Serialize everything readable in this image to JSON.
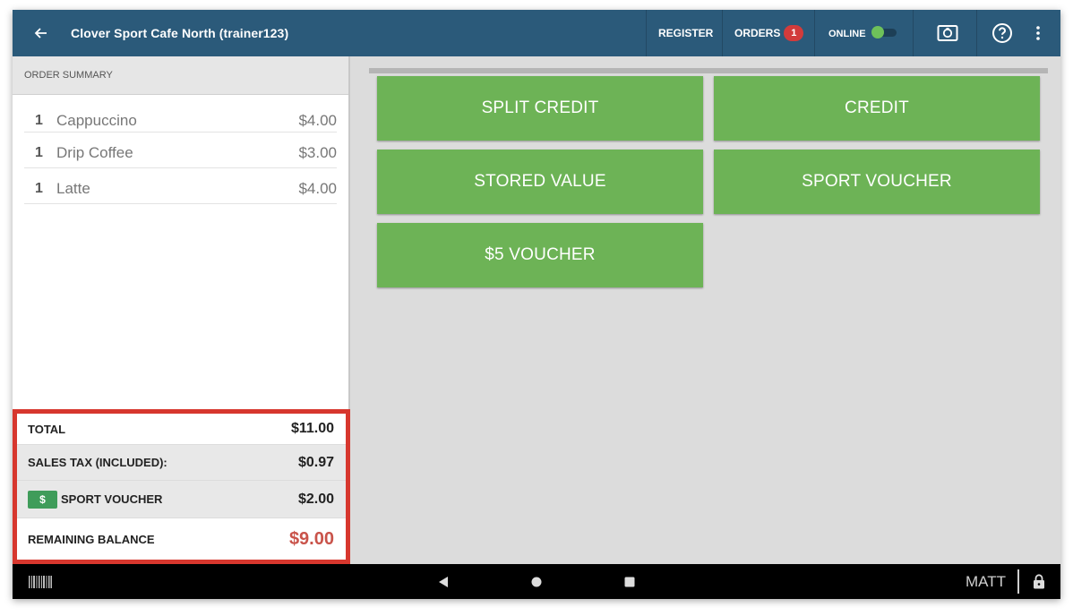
{
  "header": {
    "title": "Clover Sport Cafe North (trainer123)",
    "register_label": "REGISTER",
    "orders_label": "ORDERS",
    "orders_count": "1",
    "online_label": "ONLINE"
  },
  "order_summary": {
    "header": "ORDER SUMMARY",
    "items": [
      {
        "qty": "1",
        "name": "Cappuccino",
        "price": "$4.00"
      },
      {
        "qty": "1",
        "name": "Drip Coffee",
        "price": "$3.00"
      },
      {
        "qty": "1",
        "name": "Latte",
        "price": "$4.00"
      }
    ],
    "totals": {
      "total_label": "TOTAL",
      "total_value": "$11.00",
      "tax_label": "SALES TAX (INCLUDED):",
      "tax_value": "$0.97",
      "voucher_icon": "$",
      "voucher_label": "SPORT VOUCHER",
      "voucher_value": "$2.00",
      "balance_label": "REMAINING BALANCE",
      "balance_value": "$9.00"
    }
  },
  "tenders": [
    {
      "label": "SPLIT CREDIT"
    },
    {
      "label": "CREDIT"
    },
    {
      "label": "STORED VALUE"
    },
    {
      "label": "SPORT VOUCHER"
    },
    {
      "label": "$5 VOUCHER"
    }
  ],
  "footer": {
    "user": "MATT"
  },
  "colors": {
    "header_bg": "#2b5a7a",
    "tender_green": "#6db356",
    "highlight_red": "#d7372e",
    "balance_red": "#c9534a",
    "badge_red": "#d23b3b"
  }
}
